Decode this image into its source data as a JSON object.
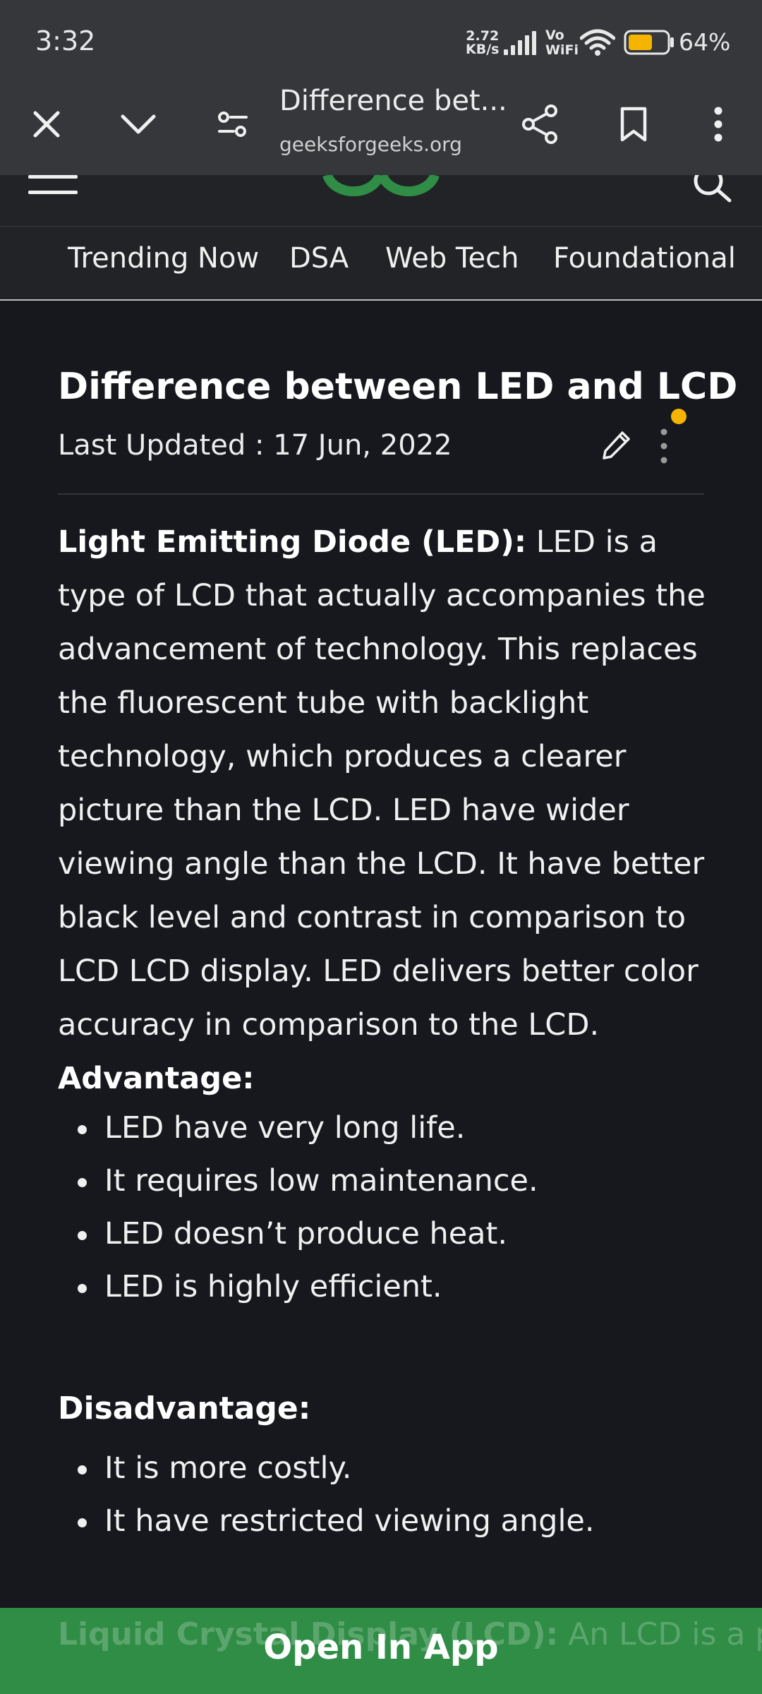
{
  "status_bar": {
    "time": "3:32",
    "net_speed_value": "2.72",
    "net_speed_unit": "KB/s",
    "vowifi_line1": "Vo",
    "vowifi_line2": "WiFi",
    "battery_percent": "64%",
    "battery_level": 0.64
  },
  "toolbar": {
    "page_title": "Difference bet...",
    "url": "geeksforgeeks.org"
  },
  "nav": {
    "items": [
      "Trending Now",
      "DSA",
      "Web Tech",
      "Foundational"
    ]
  },
  "article": {
    "title": "Difference between LED and LCD",
    "last_updated": "Last Updated : 17 Jun, 2022",
    "intro_bold": "Light Emitting Diode (LED):",
    "intro_text": " LED is a type of LCD that actually accompanies the advancement of technology. This replaces the fluorescent tube with backlight technology, which produces a clearer picture than the LCD. LED have wider viewing angle than the LCD. It have better black level and contrast in comparison to LCD LCD display. LED delivers better color accuracy in comparison to the LCD. ",
    "advantage_label": "Advantage:",
    "advantages": [
      "LED have very long life.",
      "It requires low maintenance.",
      "LED doesn’t produce heat.",
      "LED is highly efficient."
    ],
    "disadvantage_label": "Disadvantage:",
    "disadvantages": [
      "It is more costly.",
      "It have restricted viewing angle."
    ],
    "next_bold": "Liquid Crystal Display (LCD):",
    "next_text": " An LCD is a passive device, which means that it"
  },
  "banner": {
    "label": "Open In App"
  },
  "colors": {
    "brand_green": "#2f8d46",
    "notification_dot": "#f5b400",
    "battery_fill": "#f5b400"
  }
}
